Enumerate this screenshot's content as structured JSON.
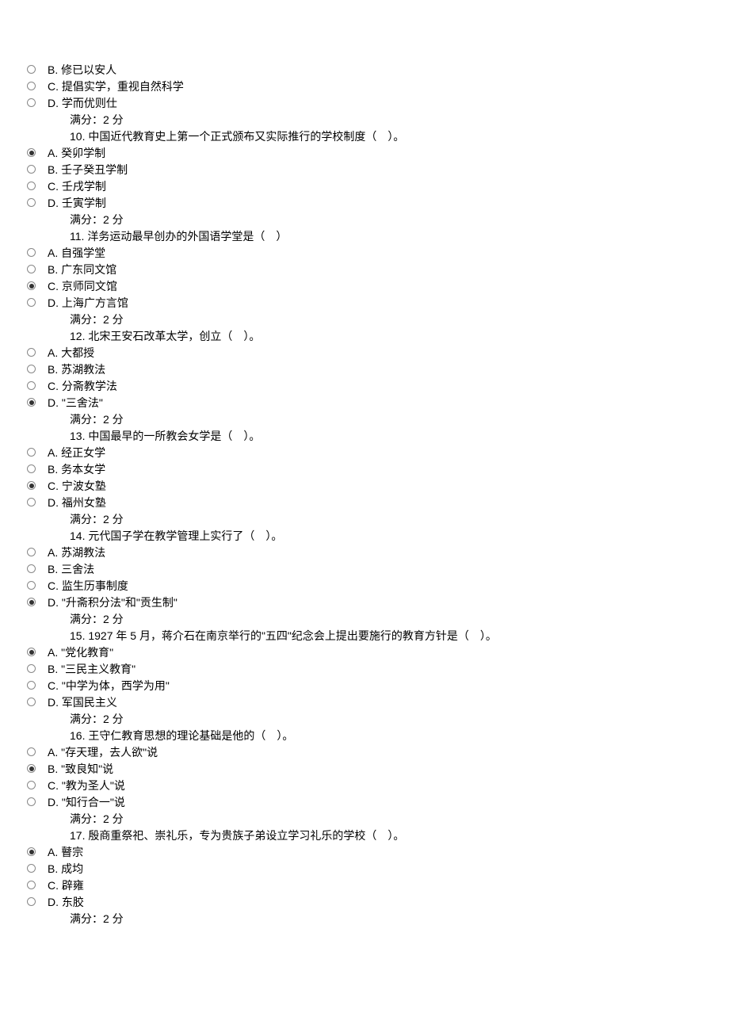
{
  "ptsLabel": "满分：2 分",
  "items": [
    {
      "type": "opt",
      "letter": "B",
      "sel": false,
      "text": "修已以安人"
    },
    {
      "type": "opt",
      "letter": "C",
      "sel": false,
      "text": "提倡实学，重视自然科学"
    },
    {
      "type": "opt",
      "letter": "D",
      "sel": false,
      "text": "学而优则仕"
    },
    {
      "type": "pts"
    },
    {
      "type": "q",
      "num": "10",
      "text": "中国近代教育史上第一个正式颁布又实际推行的学校制度（　）。"
    },
    {
      "type": "opt",
      "letter": "A",
      "sel": true,
      "text": "癸卯学制"
    },
    {
      "type": "opt",
      "letter": "B",
      "sel": false,
      "text": "壬子癸丑学制"
    },
    {
      "type": "opt",
      "letter": "C",
      "sel": false,
      "text": "壬戌学制"
    },
    {
      "type": "opt",
      "letter": "D",
      "sel": false,
      "text": "壬寅学制"
    },
    {
      "type": "pts"
    },
    {
      "type": "q",
      "num": "11",
      "text": "洋务运动最早创办的外国语学堂是（　）"
    },
    {
      "type": "opt",
      "letter": "A",
      "sel": false,
      "text": "自强学堂"
    },
    {
      "type": "opt",
      "letter": "B",
      "sel": false,
      "text": "广东同文馆"
    },
    {
      "type": "opt",
      "letter": "C",
      "sel": true,
      "text": "京师同文馆"
    },
    {
      "type": "opt",
      "letter": "D",
      "sel": false,
      "text": "上海广方言馆"
    },
    {
      "type": "pts"
    },
    {
      "type": "q",
      "num": "12",
      "text": "北宋王安石改革太学，创立（　）。"
    },
    {
      "type": "opt",
      "letter": "A",
      "sel": false,
      "text": "大都授"
    },
    {
      "type": "opt",
      "letter": "B",
      "sel": false,
      "text": "苏湖教法"
    },
    {
      "type": "opt",
      "letter": "C",
      "sel": false,
      "text": "分斋教学法"
    },
    {
      "type": "opt",
      "letter": "D",
      "sel": true,
      "text": "\"三舍法\""
    },
    {
      "type": "pts"
    },
    {
      "type": "q",
      "num": "13",
      "text": "中国最早的一所教会女学是（　）。"
    },
    {
      "type": "opt",
      "letter": "A",
      "sel": false,
      "text": "经正女学"
    },
    {
      "type": "opt",
      "letter": "B",
      "sel": false,
      "text": "务本女学"
    },
    {
      "type": "opt",
      "letter": "C",
      "sel": true,
      "text": "宁波女塾"
    },
    {
      "type": "opt",
      "letter": "D",
      "sel": false,
      "text": "福州女塾"
    },
    {
      "type": "pts"
    },
    {
      "type": "q",
      "num": "14",
      "text": "元代国子学在教学管理上实行了（　）。"
    },
    {
      "type": "opt",
      "letter": "A",
      "sel": false,
      "text": "苏湖教法"
    },
    {
      "type": "opt",
      "letter": "B",
      "sel": false,
      "text": "三舍法"
    },
    {
      "type": "opt",
      "letter": "C",
      "sel": false,
      "text": "监生历事制度"
    },
    {
      "type": "opt",
      "letter": "D",
      "sel": true,
      "text": "\"升斋积分法\"和\"贡生制\""
    },
    {
      "type": "pts"
    },
    {
      "type": "q",
      "num": "15",
      "text": "1927 年 5 月，蒋介石在南京举行的\"五四\"纪念会上提出要施行的教育方针是（　）。"
    },
    {
      "type": "opt",
      "letter": "A",
      "sel": true,
      "text": "\"党化教育\""
    },
    {
      "type": "opt",
      "letter": "B",
      "sel": false,
      "text": "\"三民主义教育\""
    },
    {
      "type": "opt",
      "letter": "C",
      "sel": false,
      "text": "\"中学为体，西学为用\""
    },
    {
      "type": "opt",
      "letter": "D",
      "sel": false,
      "text": "军国民主义"
    },
    {
      "type": "pts"
    },
    {
      "type": "q",
      "num": "16",
      "text": "王守仁教育思想的理论基础是他的（　）。"
    },
    {
      "type": "opt",
      "letter": "A",
      "sel": false,
      "text": "\"存天理，去人欲\"说"
    },
    {
      "type": "opt",
      "letter": "B",
      "sel": true,
      "text": "\"致良知\"说"
    },
    {
      "type": "opt",
      "letter": "C",
      "sel": false,
      "text": "\"教为圣人\"说"
    },
    {
      "type": "opt",
      "letter": "D",
      "sel": false,
      "text": "\"知行合一\"说"
    },
    {
      "type": "pts"
    },
    {
      "type": "q",
      "num": "17",
      "text": "殷商重祭祀、崇礼乐，专为贵族子弟设立学习礼乐的学校（　）。"
    },
    {
      "type": "opt",
      "letter": "A",
      "sel": true,
      "text": "瞽宗"
    },
    {
      "type": "opt",
      "letter": "B",
      "sel": false,
      "text": "成均"
    },
    {
      "type": "opt",
      "letter": "C",
      "sel": false,
      "text": "辟雍"
    },
    {
      "type": "opt",
      "letter": "D",
      "sel": false,
      "text": "东胶"
    },
    {
      "type": "pts"
    }
  ]
}
